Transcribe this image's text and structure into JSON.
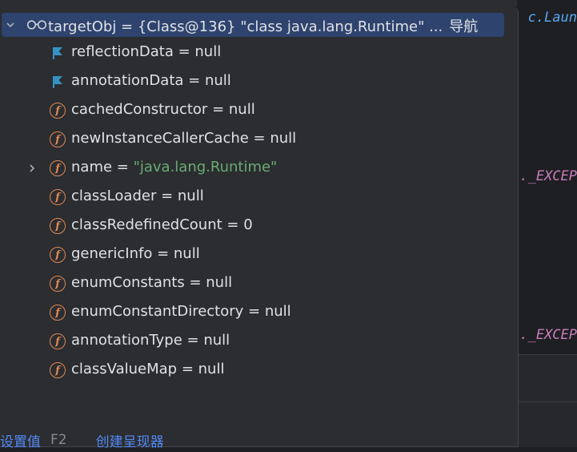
{
  "editor": {
    "fragment_top": "c.Laun",
    "fragment_mid1": "._EXCEP",
    "fragment_mid2": "._EXCEP"
  },
  "selected_row": {
    "name": "targetObj",
    "equals": " = ",
    "value": "{Class@136} \"class java.lang.Runtime\" ...",
    "nav_link": "导航"
  },
  "rows": [
    {
      "icon": "flag-icon",
      "name": "reflectionData",
      "equals": " = ",
      "value": "null"
    },
    {
      "icon": "flag-icon",
      "name": "annotationData",
      "equals": " = ",
      "value": "null"
    },
    {
      "icon": "field-icon",
      "name": "cachedConstructor",
      "equals": " = ",
      "value": "null"
    },
    {
      "icon": "field-icon",
      "name": "newInstanceCallerCache",
      "equals": " = ",
      "value": "null"
    },
    {
      "icon": "field-icon",
      "name": "name",
      "equals": " = ",
      "value": "\"java.lang.Runtime\"",
      "expandable": true
    },
    {
      "icon": "field-icon",
      "name": "classLoader",
      "equals": " = ",
      "value": "null"
    },
    {
      "icon": "field-icon",
      "name": "classRedefinedCount",
      "equals": " = ",
      "value": "0"
    },
    {
      "icon": "field-icon",
      "name": "genericInfo",
      "equals": " = ",
      "value": "null"
    },
    {
      "icon": "field-icon",
      "name": "enumConstants",
      "equals": " = ",
      "value": "null"
    },
    {
      "icon": "field-icon",
      "name": "enumConstantDirectory",
      "equals": " = ",
      "value": "null"
    },
    {
      "icon": "field-icon",
      "name": "annotationType",
      "equals": " = ",
      "value": "null"
    },
    {
      "icon": "field-icon",
      "name": "classValueMap",
      "equals": " = ",
      "value": "null"
    }
  ],
  "footer": {
    "set_value": "设置值",
    "set_value_shortcut": "F2",
    "create_renderer": "创建呈现器"
  },
  "colors": {
    "field_icon": "#e08855",
    "flag_icon": "#3592c4",
    "string_value": "#6aab73",
    "link": "#548af7",
    "selection": "#2e436e"
  }
}
